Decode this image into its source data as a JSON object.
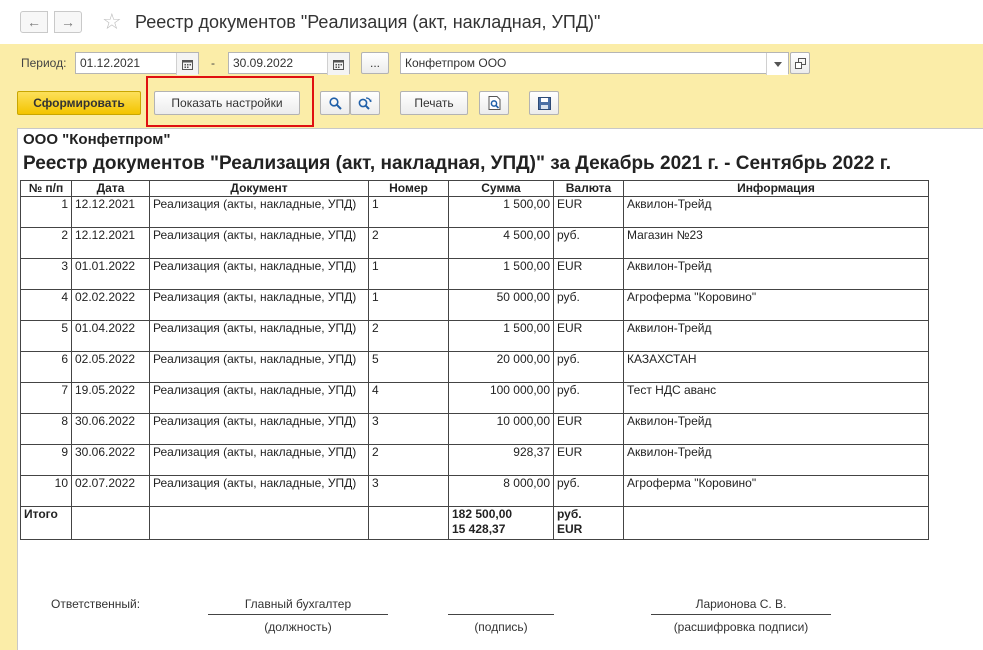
{
  "window": {
    "title": "Реестр документов \"Реализация (акт, накладная, УПД)\"",
    "back_icon": "←",
    "forward_icon": "→",
    "star_icon": "☆"
  },
  "filters": {
    "period_label": "Период:",
    "date_from": "01.12.2021",
    "dash": "-",
    "date_to": "30.09.2022",
    "ellipsis": "...",
    "organization": "Конфетпром ООО"
  },
  "toolbar": {
    "generate": "Сформировать",
    "show_settings": "Показать настройки",
    "print": "Печать"
  },
  "report": {
    "org": "ООО \"Конфетпром\"",
    "title": "Реестр документов \"Реализация (акт, накладная, УПД)\" за Декабрь 2021 г. - Сентябрь 2022 г.",
    "columns": [
      "№ п/п",
      "Дата",
      "Документ",
      "Номер",
      "Сумма",
      "Валюта",
      "Информация"
    ],
    "rows": [
      {
        "n": "1",
        "date": "12.12.2021",
        "doc": "Реализация (акты, накладные, УПД)",
        "num": "1",
        "sum": "1 500,00",
        "cur": "EUR",
        "info": "Аквилон-Трейд"
      },
      {
        "n": "2",
        "date": "12.12.2021",
        "doc": "Реализация (акты, накладные, УПД)",
        "num": "2",
        "sum": "4 500,00",
        "cur": "руб.",
        "info": "Магазин №23"
      },
      {
        "n": "3",
        "date": "01.01.2022",
        "doc": "Реализация (акты, накладные, УПД)",
        "num": "1",
        "sum": "1 500,00",
        "cur": "EUR",
        "info": "Аквилон-Трейд"
      },
      {
        "n": "4",
        "date": "02.02.2022",
        "doc": "Реализация (акты, накладные, УПД)",
        "num": "1",
        "sum": "50 000,00",
        "cur": "руб.",
        "info": "Агроферма \"Коровино\""
      },
      {
        "n": "5",
        "date": "01.04.2022",
        "doc": "Реализация (акты, накладные, УПД)",
        "num": "2",
        "sum": "1 500,00",
        "cur": "EUR",
        "info": "Аквилон-Трейд"
      },
      {
        "n": "6",
        "date": "02.05.2022",
        "doc": "Реализация (акты, накладные, УПД)",
        "num": "5",
        "sum": "20 000,00",
        "cur": "руб.",
        "info": "КАЗАХСТАН"
      },
      {
        "n": "7",
        "date": "19.05.2022",
        "doc": "Реализация (акты, накладные, УПД)",
        "num": "4",
        "sum": "100 000,00",
        "cur": "руб.",
        "info": "Тест НДС аванс"
      },
      {
        "n": "8",
        "date": "30.06.2022",
        "doc": "Реализация (акты, накладные, УПД)",
        "num": "3",
        "sum": "10 000,00",
        "cur": "EUR",
        "info": "Аквилон-Трейд"
      },
      {
        "n": "9",
        "date": "30.06.2022",
        "doc": "Реализация (акты, накладные, УПД)",
        "num": "2",
        "sum": "928,37",
        "cur": "EUR",
        "info": "Аквилон-Трейд"
      },
      {
        "n": "10",
        "date": "02.07.2022",
        "doc": "Реализация (акты, накладные, УПД)",
        "num": "3",
        "sum": "8 000,00",
        "cur": "руб.",
        "info": "Агроферма \"Коровино\""
      }
    ],
    "total": {
      "label": "Итого",
      "sum_rub": "182 500,00",
      "sum_eur": "15 428,37",
      "cur_rub": "руб.",
      "cur_eur": "EUR"
    }
  },
  "signature": {
    "responsible_label": "Ответственный:",
    "position_value": "Главный бухгалтер",
    "position_caption": "(должность)",
    "signature_caption": "(подпись)",
    "name_value": "Ларионова С. В.",
    "name_caption": "(расшифровка подписи)"
  }
}
